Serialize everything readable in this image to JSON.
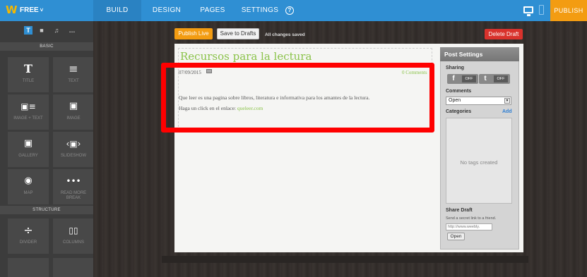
{
  "topbar": {
    "logo": "W",
    "plan_label": "FREE",
    "plan_chevron": "˅",
    "nav": [
      "BUILD",
      "DESIGN",
      "PAGES",
      "SETTINGS"
    ],
    "help_icon": "?",
    "publish_label": "PUBLISH",
    "colors": {
      "bar": "#2f8fd3",
      "publish": "#f39c12"
    }
  },
  "sidebar": {
    "tools": [
      "T",
      "■",
      "♫",
      "…"
    ],
    "basic_header": "BASIC",
    "structure_header": "STRUCTURE",
    "elements": [
      {
        "label": "TITLE",
        "icon": "T"
      },
      {
        "label": "TEXT",
        "icon": "≡"
      },
      {
        "label": "IMAGE + TEXT",
        "icon": "▣≡"
      },
      {
        "label": "IMAGE",
        "icon": "▣"
      },
      {
        "label": "GALLERY",
        "icon": "▣"
      },
      {
        "label": "SLIDESHOW",
        "icon": "‹▣›"
      },
      {
        "label": "MAP",
        "icon": "◉"
      },
      {
        "label": "READ MORE BREAK",
        "icon": "•••"
      },
      {
        "label": "DIVIDER",
        "icon": "÷"
      },
      {
        "label": "COLUMNS",
        "icon": "▯▯"
      }
    ]
  },
  "editor": {
    "publish_live": "Publish Live",
    "save_to_drafts": "Save to Drafts",
    "status": "All changes saved",
    "delete_draft": "Delete Draft"
  },
  "post": {
    "title": "Recursos para la lectura",
    "date": "07/09/2015",
    "comments": "0 Comments",
    "body_line1": "Que leer es una pagina sobre libros, literatura e informativa para los amantes de la lectura.",
    "body_line2_prefix": "Haga un click en el enlace:  ",
    "link_text": "queleer.com"
  },
  "post_settings": {
    "header": "Post Settings",
    "sharing_label": "Sharing",
    "facebook_icon": "f",
    "twitter_icon": "t",
    "off_label": "OFF",
    "comments_label": "Comments",
    "comments_value": "Open",
    "categories_label": "Categories",
    "add_label": "Add",
    "no_tags": "No tags created",
    "share_draft_label": "Share Draft",
    "share_draft_sub": "Send a secret link to a friend.",
    "share_link": "http://www.weebly.",
    "open_button": "Open"
  }
}
